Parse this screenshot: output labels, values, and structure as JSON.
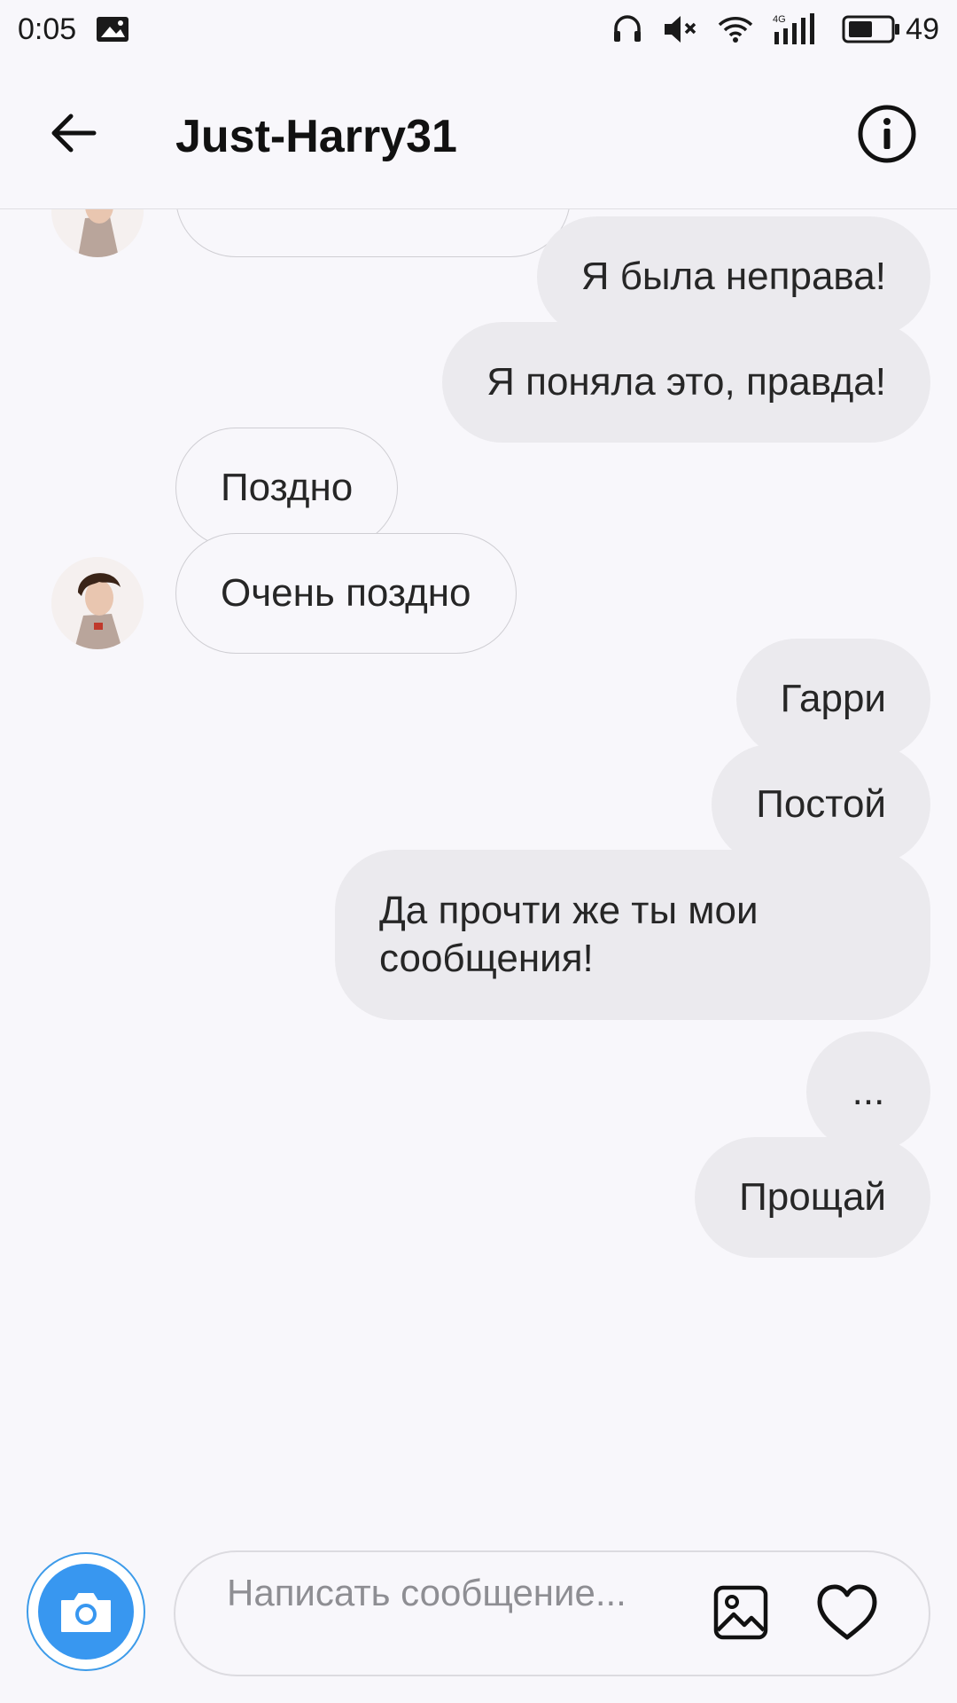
{
  "status_bar": {
    "time": "0:05",
    "battery": "49",
    "icons": [
      "image-notification-icon",
      "headphones-icon",
      "mute-icon",
      "wifi-icon",
      "4g-signal-icon",
      "battery-icon"
    ],
    "network_label": "4G"
  },
  "header": {
    "title": "Just-Harry31",
    "back_icon": "arrow-left-icon",
    "info_icon": "info-circle-icon"
  },
  "messages": [
    {
      "from": "me",
      "text": "Я была неправа!"
    },
    {
      "from": "me",
      "text": "Я поняла это, правда!"
    },
    {
      "from": "them",
      "text": "Поздно"
    },
    {
      "from": "them",
      "text": "Очень поздно"
    },
    {
      "from": "me",
      "text": "Гарри"
    },
    {
      "from": "me",
      "text": "Постой"
    },
    {
      "from": "me",
      "text": "Да прочти же ты мои сообщения!"
    },
    {
      "from": "me",
      "text": "..."
    },
    {
      "from": "me",
      "text": "Прощай"
    }
  ],
  "composer": {
    "placeholder": "Написать сообщение...",
    "camera_icon": "camera-icon",
    "gallery_icon": "image-icon",
    "like_icon": "heart-icon"
  },
  "colors": {
    "outgoing_bubble": "#ebeaee",
    "incoming_border": "#cfced3",
    "accent": "#3897f0",
    "background": "#f8f7fb"
  }
}
